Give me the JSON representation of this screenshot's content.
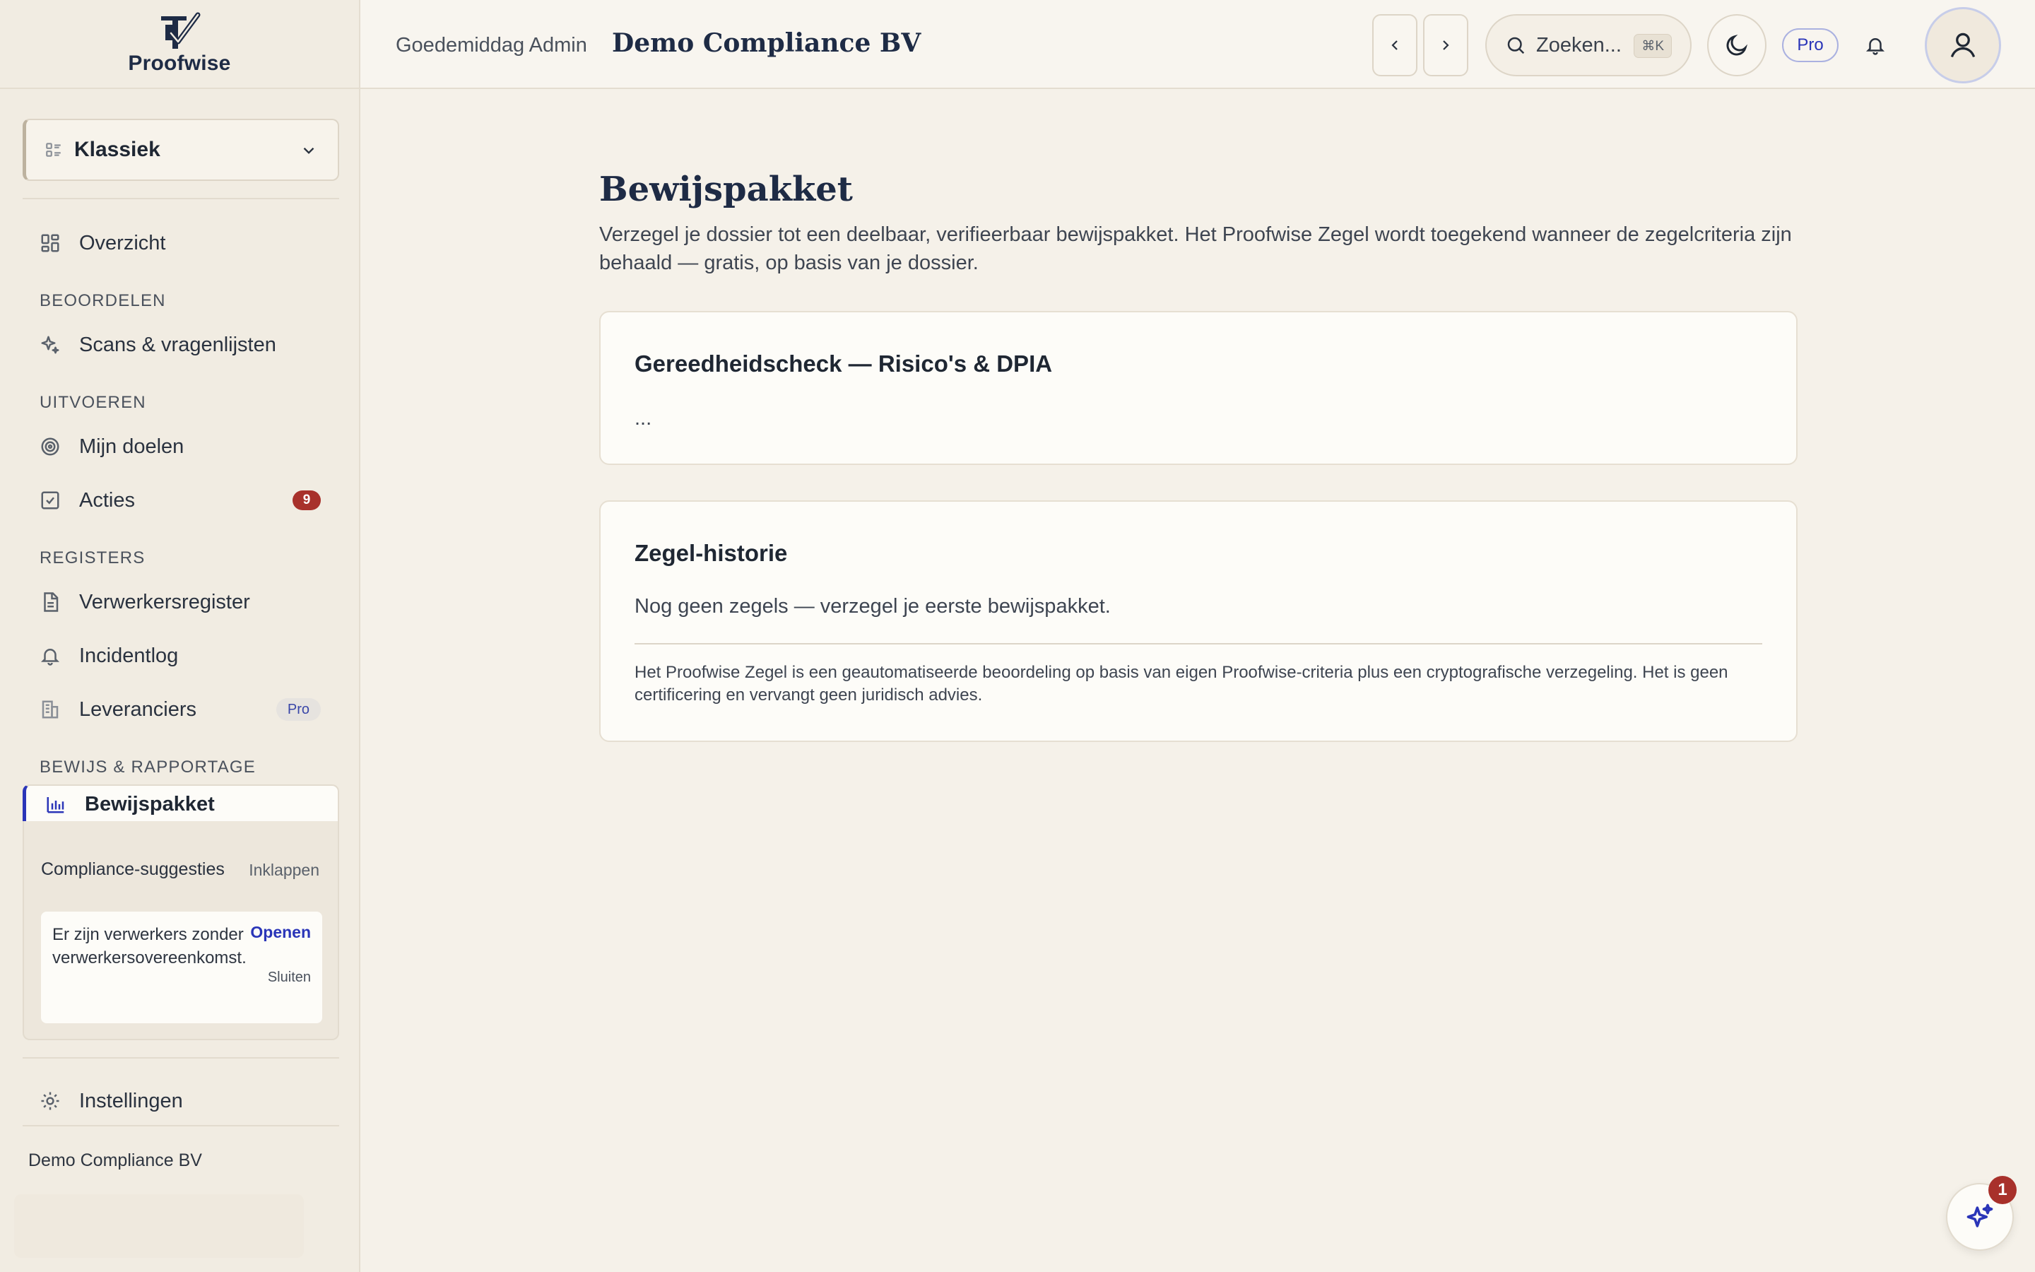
{
  "brand": {
    "name": "Proofwise"
  },
  "sidebar": {
    "view_selector": {
      "value": "Klassiek"
    },
    "overview": {
      "label": "Overzicht"
    },
    "sections": [
      {
        "heading": "BEOORDELEN"
      },
      {
        "heading": "UITVOEREN"
      },
      {
        "heading": "REGISTERS"
      },
      {
        "heading": "BEWIJS & RAPPORTAGE"
      }
    ],
    "items": [
      {
        "label": "Scans & vragenlijsten"
      },
      {
        "label": "Mijn doelen"
      },
      {
        "label": "Acties",
        "badge": "9"
      },
      {
        "label": "Verwerkersregister"
      },
      {
        "label": "Incidentlog"
      },
      {
        "label": "Leveranciers",
        "badge": "Pro"
      },
      {
        "label": "Bewijspakket",
        "active": true
      }
    ],
    "suggestions": {
      "title": "Compliance-suggesties",
      "collapse_label": "Inklappen",
      "item_text": "Er zijn verwerkers zonder verwerkersovereenkomst.",
      "open_label": "Openen",
      "close_label": "Sluiten"
    },
    "settings": {
      "label": "Instellingen"
    },
    "org_name": "Demo Compliance BV"
  },
  "header": {
    "greeting": "Goedemiddag Admin",
    "company": "Demo Compliance BV",
    "search": {
      "placeholder": "Zoeken...",
      "shortcut": "⌘K"
    },
    "pro_label": "Pro"
  },
  "main": {
    "title": "Bewijspakket",
    "description": "Verzegel je dossier tot een deelbaar, verifieerbaar bewijspakket. Het Proofwise Zegel wordt toegekend wanneer de zegelcriteria zijn behaald — gratis, op basis van je dossier.",
    "readiness_card": {
      "title": "Gereedheidscheck — Risico's & DPIA",
      "body": "..."
    },
    "history_card": {
      "title": "Zegel-historie",
      "empty_text": "Nog geen zegels — verzegel je eerste bewijspakket.",
      "disclaimer": "Het Proofwise Zegel is een geautomatiseerde beoordeling op basis van eigen Proofwise-criteria plus een cryptografische verzegeling. Het is geen certificering en vervangt geen juridisch advies."
    }
  },
  "assistant": {
    "badge": "1"
  },
  "colors": {
    "accent": "#2a35b8",
    "badge_red": "#a8312b",
    "navy": "#1e2b45"
  }
}
